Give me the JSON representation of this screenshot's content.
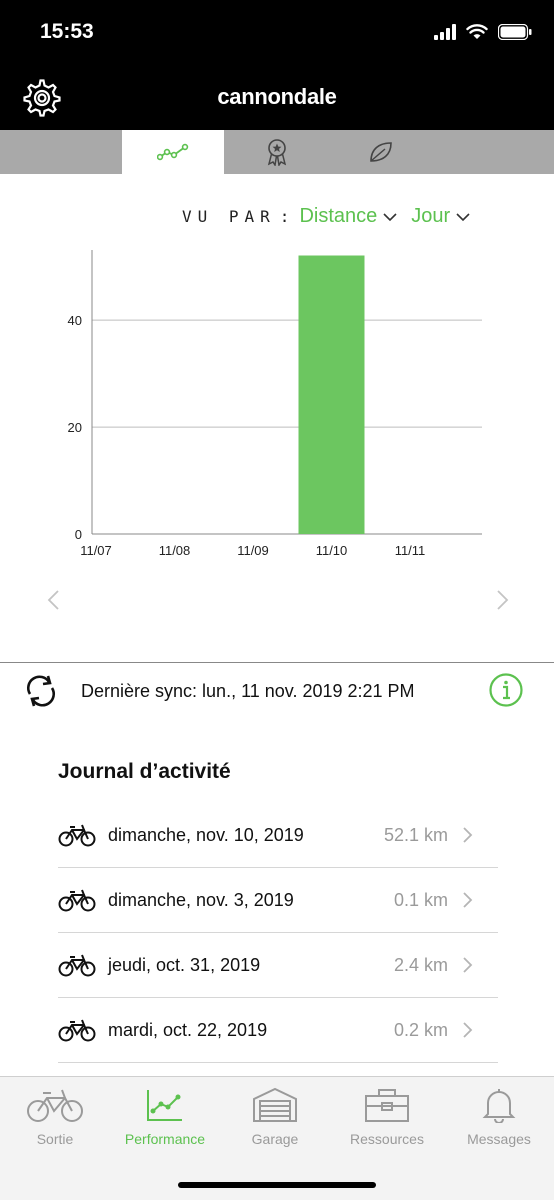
{
  "status_bar": {
    "time": "15:53"
  },
  "header": {
    "brand": "cannondale"
  },
  "colors": {
    "accent": "#5cc14f",
    "tab_bar": "#a9a9a9",
    "header": "#000000"
  },
  "tabs": [
    {
      "icon": "trend-line-icon",
      "active": true
    },
    {
      "icon": "award-ribbon-icon",
      "active": false
    },
    {
      "icon": "leaf-icon",
      "active": false
    }
  ],
  "view_by": {
    "label": "VU PAR",
    "colon": ":",
    "metric": "Distance",
    "period": "Jour"
  },
  "chart_data": {
    "type": "bar",
    "categories": [
      "11/07",
      "11/08",
      "11/09",
      "11/10",
      "11/11"
    ],
    "values": [
      0,
      0,
      0,
      52.1,
      0
    ],
    "yticks": [
      0,
      20,
      40
    ],
    "ylim": [
      0,
      55
    ],
    "grid": true,
    "bar_color": "#6cc660"
  },
  "sync": {
    "text": "Dernière sync: lun., 11 nov. 2019 2:21 PM"
  },
  "journal": {
    "title": "Journal d’activité",
    "entries": [
      {
        "date": "dimanche, nov. 10, 2019",
        "distance": "52.1 km"
      },
      {
        "date": "dimanche, nov. 3, 2019",
        "distance": "0.1 km"
      },
      {
        "date": "jeudi, oct. 31, 2019",
        "distance": "2.4 km"
      },
      {
        "date": "mardi, oct. 22, 2019",
        "distance": "0.2 km"
      }
    ]
  },
  "bottom_nav": [
    {
      "label": "Sortie",
      "icon": "bike-icon",
      "active": false
    },
    {
      "label": "Performance",
      "icon": "chart-icon",
      "active": true
    },
    {
      "label": "Garage",
      "icon": "garage-icon",
      "active": false
    },
    {
      "label": "Ressources",
      "icon": "toolbox-icon",
      "active": false
    },
    {
      "label": "Messages",
      "icon": "bell-icon",
      "active": false
    }
  ]
}
